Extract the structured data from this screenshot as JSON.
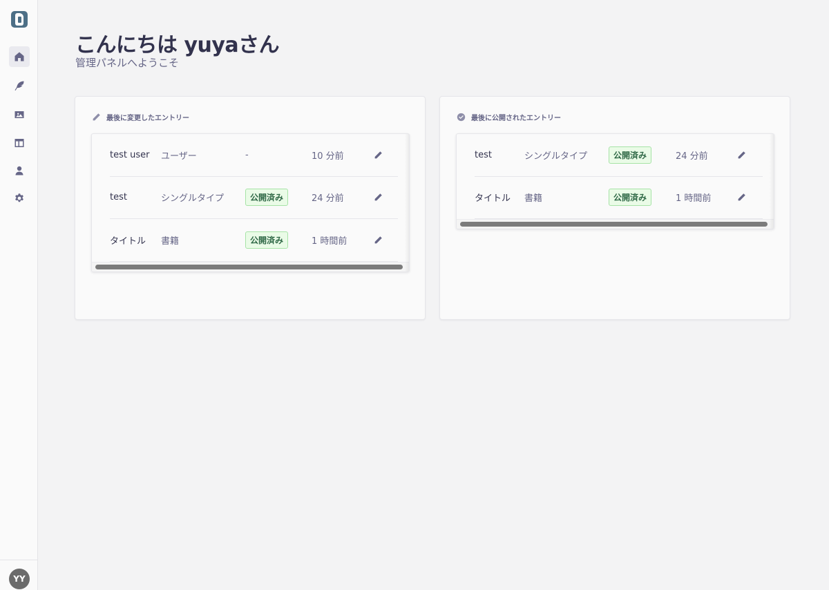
{
  "sidebar": {
    "logo_icon": "strapi-logo-icon",
    "items": [
      {
        "name": "home",
        "icon": "home-icon",
        "active": true
      },
      {
        "name": "content-manager",
        "icon": "feather-icon",
        "active": false
      },
      {
        "name": "media-library",
        "icon": "image-icon",
        "active": false
      },
      {
        "name": "content-type-builder",
        "icon": "layout-icon",
        "active": false
      },
      {
        "name": "users",
        "icon": "user-icon",
        "active": false
      },
      {
        "name": "settings",
        "icon": "gear-icon",
        "active": false
      }
    ],
    "avatar_initials": "YY"
  },
  "header": {
    "title": "こんにちは yuyaさん",
    "subtitle": "管理パネルへようこそ"
  },
  "cards": {
    "last_edited": {
      "title": "最後に変更したエントリー",
      "icon": "pencil-icon",
      "rows": [
        {
          "title": "test user",
          "type": "ユーザー",
          "status": "-",
          "status_badge": false,
          "time": "10 分前"
        },
        {
          "title": "test",
          "type": "シングルタイプ",
          "status": "公開済み",
          "status_badge": true,
          "time": "24 分前"
        },
        {
          "title": "タイトル",
          "type": "書籍",
          "status": "公開済み",
          "status_badge": true,
          "time": "1 時間前"
        }
      ]
    },
    "last_published": {
      "title": "最後に公開されたエントリー",
      "icon": "check-circle-icon",
      "rows": [
        {
          "title": "test",
          "type": "シングルタイプ",
          "status": "公開済み",
          "status_badge": true,
          "time": "24 分前"
        },
        {
          "title": "タイトル",
          "type": "書籍",
          "status": "公開済み",
          "status_badge": true,
          "time": "1 時間前"
        }
      ]
    }
  },
  "colors": {
    "badge_text": "#2f6846",
    "badge_bg": "#eafbe7",
    "badge_border": "#a6e3a6",
    "page_bg": "#f3f3f4"
  }
}
